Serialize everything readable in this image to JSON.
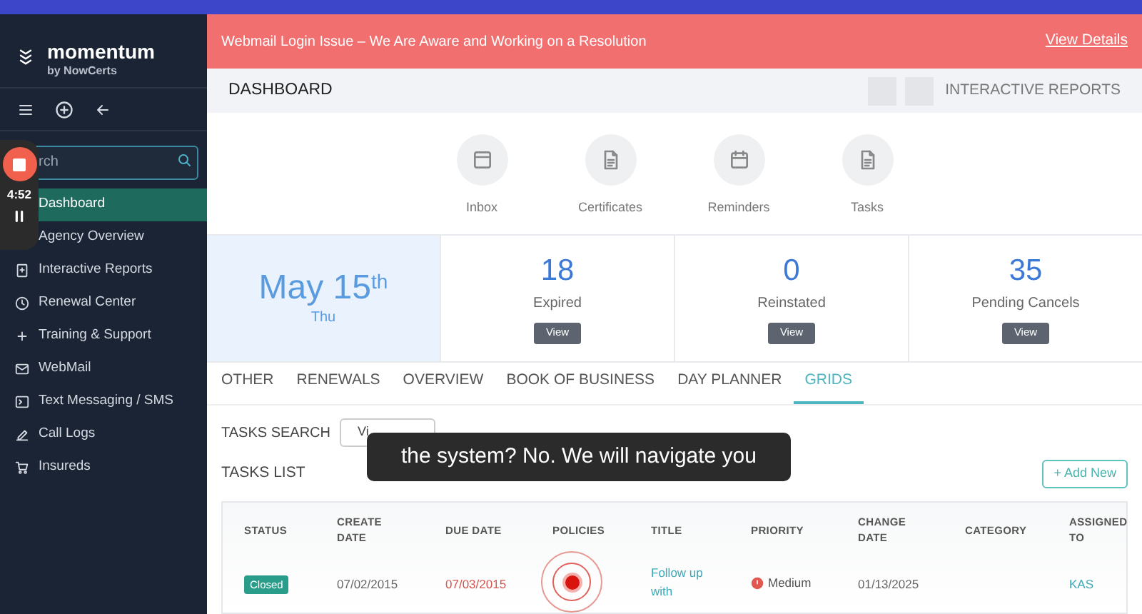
{
  "sidebar": {
    "brand": "momentum",
    "brand_sub": "by NowCerts",
    "search": {
      "placeholder": "rch"
    },
    "items": [
      {
        "label": "Dashboard",
        "selected": true
      },
      {
        "label": "Agency Overview",
        "selected": false
      },
      {
        "label": "Interactive Reports",
        "selected": false
      },
      {
        "label": "Renewal Center",
        "selected": false
      },
      {
        "label": "Training & Support",
        "selected": false
      },
      {
        "label": "WebMail",
        "selected": false
      },
      {
        "label": "Text Messaging / SMS",
        "selected": false
      },
      {
        "label": "Call Logs",
        "selected": false
      },
      {
        "label": "Insureds",
        "selected": false
      }
    ]
  },
  "recorder": {
    "time": "4:52"
  },
  "banner": {
    "text": "Webmail Login Issue – We Are Aware and Working on a Resolution",
    "link": "View Details"
  },
  "header": {
    "title": "DASHBOARD",
    "link": "INTERACTIVE REPORTS"
  },
  "quick_links": [
    {
      "label": "Inbox"
    },
    {
      "label": "Certificates"
    },
    {
      "label": "Reminders"
    },
    {
      "label": "Tasks"
    }
  ],
  "date": {
    "text": "May 15",
    "suffix": "th",
    "weekday": "Thu"
  },
  "stats": [
    {
      "value": "18",
      "label": "Expired",
      "button": "View"
    },
    {
      "value": "0",
      "label": "Reinstated",
      "button": "View"
    },
    {
      "value": "35",
      "label": "Pending Cancels",
      "button": "View"
    }
  ],
  "tabs": [
    {
      "label": "OTHER",
      "selected": false
    },
    {
      "label": "RENEWALS",
      "selected": false
    },
    {
      "label": "OVERVIEW",
      "selected": false
    },
    {
      "label": "BOOK OF BUSINESS",
      "selected": false
    },
    {
      "label": "DAY PLANNER",
      "selected": false
    },
    {
      "label": "GRIDS",
      "selected": true
    }
  ],
  "tasks_search": {
    "title": "TASKS SEARCH",
    "button": "Vi"
  },
  "tasks_list": {
    "title": "TASKS LIST",
    "add_button": "+ Add New",
    "columns": [
      "STATUS",
      "CREATE DATE",
      "DUE DATE",
      "POLICIES",
      "TITLE",
      "PRIORITY",
      "CHANGE DATE",
      "CATEGORY",
      "ASSIGNED TO"
    ],
    "rows": [
      {
        "status": "Closed",
        "create_date": "07/02/2015",
        "due_date": "07/03/2015",
        "overdue": true,
        "title": "Follow up with",
        "priority": "Medium",
        "change_date": "01/13/2025",
        "assigned_to": "KAS"
      }
    ]
  },
  "caption": "the system? No. We will navigate you"
}
